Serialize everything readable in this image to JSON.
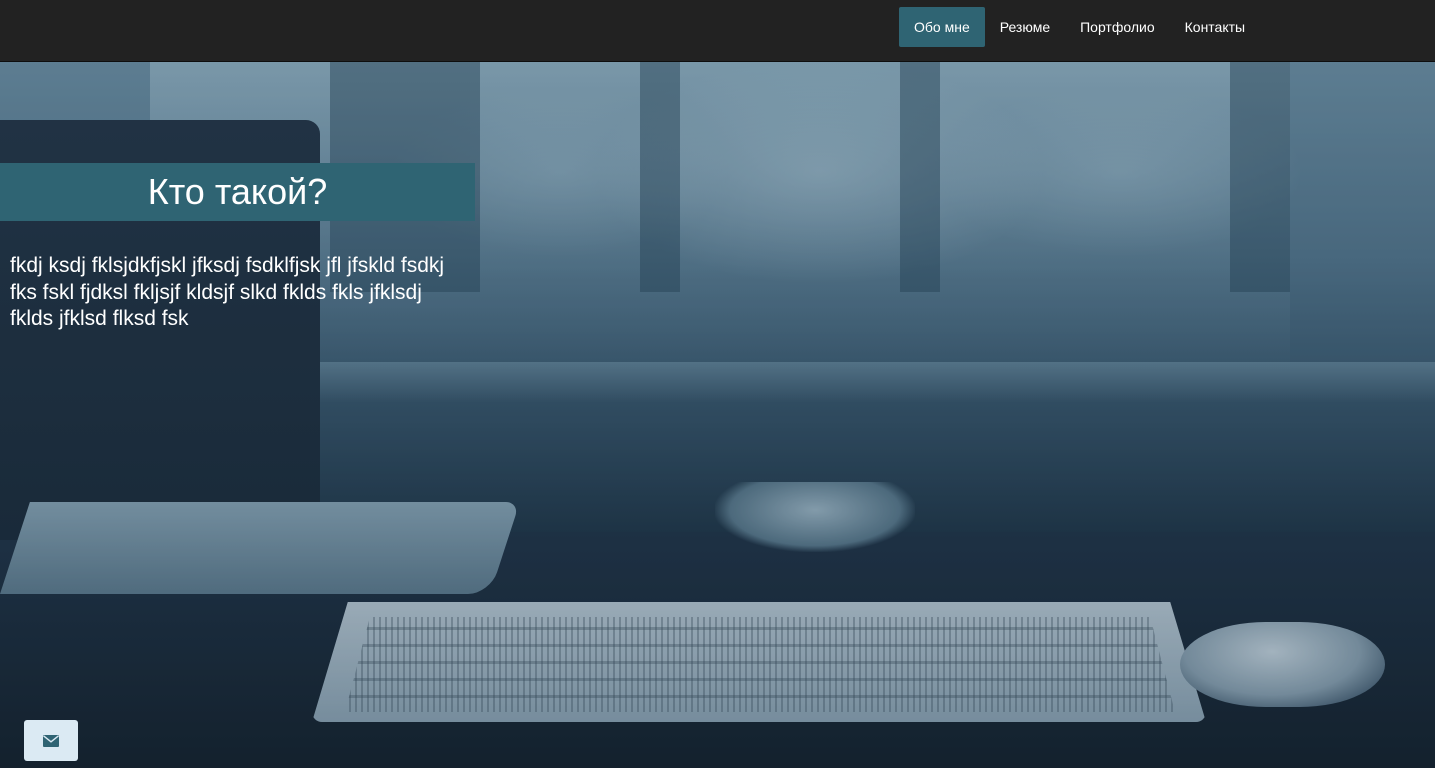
{
  "nav": {
    "items": [
      {
        "label": "Обо мне",
        "active": true
      },
      {
        "label": "Резюме",
        "active": false
      },
      {
        "label": "Портфолио",
        "active": false
      },
      {
        "label": "Контакты",
        "active": false
      }
    ]
  },
  "about": {
    "title": "Кто такой?",
    "text": "fkdj ksdj fklsjdkfjskl jfksdj fsdklfjsk jfl jfskld fsdkj fks fskl fjdksl fkljsjf kldsjf slkd fklds fkls jfklsdj fklds jfklsd flksd fsk"
  },
  "mail_button": {
    "icon": "envelope-icon"
  },
  "colors": {
    "navbar_bg": "#222222",
    "accent": "#2f6473",
    "mail_button_bg": "#dbeaf3",
    "mail_icon": "#2f6473"
  }
}
